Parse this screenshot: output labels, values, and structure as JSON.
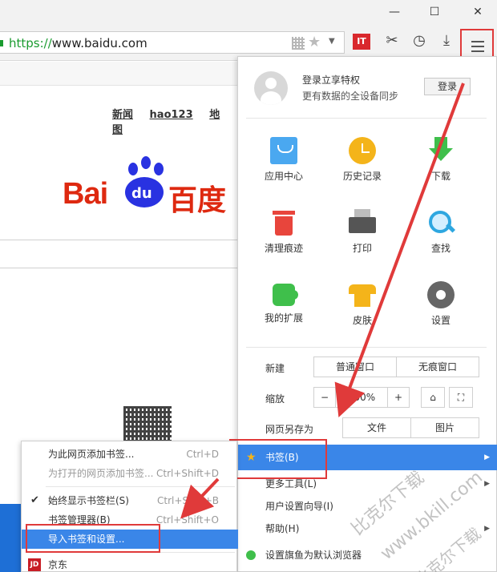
{
  "window": {
    "minimize": "—",
    "maximize": "☐",
    "close": "✕"
  },
  "addressbar": {
    "url_scheme": "https://",
    "url_rest": "www.baidu.com",
    "it_label": "IT"
  },
  "page": {
    "top_links": [
      "新闻",
      "hao123",
      "地图"
    ],
    "logo_latin": "Bai",
    "logo_du": "du",
    "logo_cn": "百度"
  },
  "menu": {
    "login_title": "登录立享特权",
    "login_subtitle": "更有数据的全设备同步",
    "login_button": "登录",
    "grid": [
      {
        "label": "应用中心",
        "icon": "app-center-icon"
      },
      {
        "label": "历史记录",
        "icon": "history-icon"
      },
      {
        "label": "下载",
        "icon": "download-icon"
      },
      {
        "label": "清理痕迹",
        "icon": "clean-icon"
      },
      {
        "label": "打印",
        "icon": "print-icon"
      },
      {
        "label": "查找",
        "icon": "search-icon"
      },
      {
        "label": "我的扩展",
        "icon": "extension-icon"
      },
      {
        "label": "皮肤",
        "icon": "skin-icon"
      },
      {
        "label": "设置",
        "icon": "settings-icon"
      }
    ],
    "new_label": "新建",
    "new_normal": "普通窗口",
    "new_private": "无痕窗口",
    "zoom_label": "缩放",
    "zoom_minus": "−",
    "zoom_value": "100%",
    "zoom_plus": "+",
    "save_label": "网页另存为",
    "save_file": "文件",
    "save_image": "图片",
    "items": [
      {
        "label": "书签(B)",
        "has_arrow": true
      },
      {
        "label": "更多工具(L)",
        "has_arrow": true
      },
      {
        "label": "用户设置向导(I)",
        "has_arrow": false
      },
      {
        "label": "帮助(H)",
        "has_arrow": true
      },
      {
        "label": "设置旗鱼为默认浏览器",
        "has_arrow": false
      }
    ]
  },
  "submenu": {
    "items": [
      {
        "label": "为此网页添加书签...",
        "shortcut": "Ctrl+D"
      },
      {
        "label": "为打开的网页添加书签...",
        "shortcut": "Ctrl+Shift+D"
      },
      {
        "label": "始终显示书签栏(S)",
        "shortcut": "Ctrl+Shift+B"
      },
      {
        "label": "书签管理器(B)",
        "shortcut": "Ctrl+Shift+O"
      },
      {
        "label": "导入书签和设置...",
        "shortcut": ""
      },
      {
        "label": "京东",
        "shortcut": ""
      }
    ],
    "jd_badge": "JD"
  },
  "watermark": {
    "line1": "比克尔下载",
    "line2": "www.bkill.com",
    "line3": "比克尔下载"
  },
  "colors": {
    "accent": "#3a86e8",
    "annotation": "#e03a3a",
    "baidu_red": "#de2910",
    "baidu_blue": "#2932e1"
  }
}
